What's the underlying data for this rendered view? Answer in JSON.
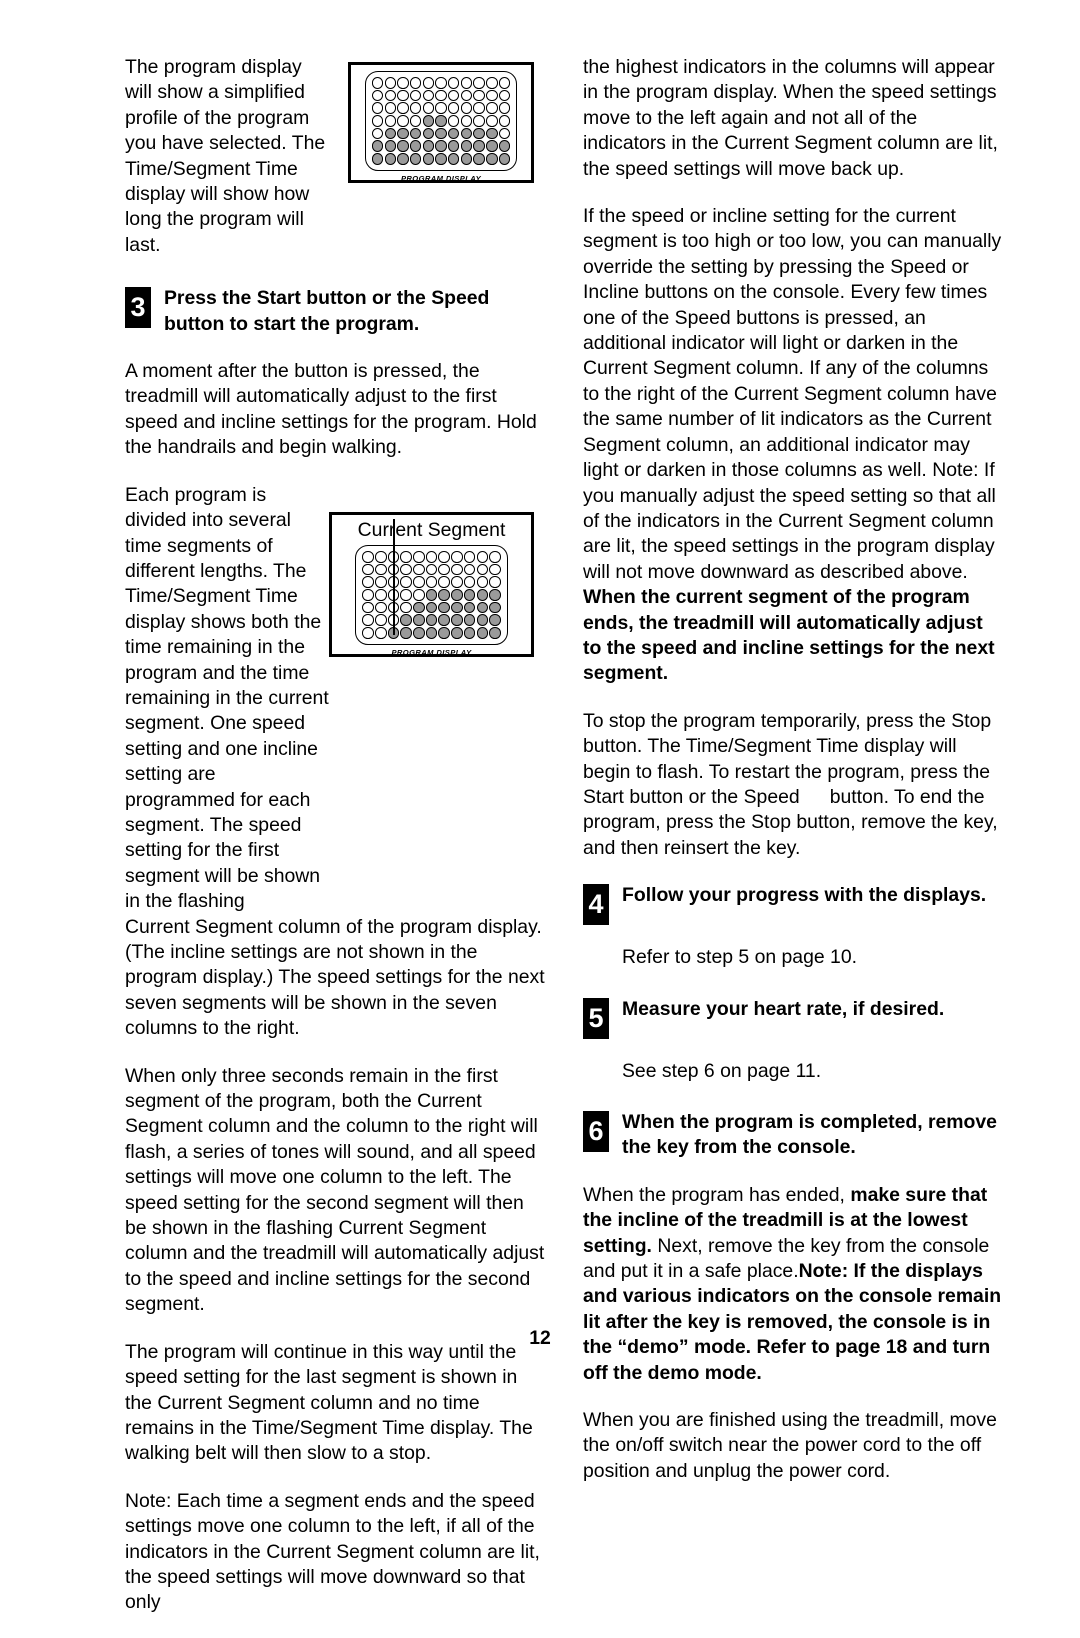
{
  "page": {
    "number": "12"
  },
  "figures": {
    "program_display": {
      "caption": "PROGRAM DISPLAY",
      "columns": 11,
      "rows": 7,
      "lit_cells": [
        [
          0,
          0,
          0,
          0,
          0,
          0,
          0,
          0,
          0,
          0,
          0
        ],
        [
          0,
          0,
          0,
          0,
          0,
          0,
          0,
          0,
          0,
          0,
          0
        ],
        [
          0,
          0,
          0,
          0,
          0,
          0,
          0,
          0,
          0,
          0,
          0
        ],
        [
          0,
          0,
          0,
          0,
          1,
          1,
          0,
          0,
          0,
          0,
          0
        ],
        [
          0,
          1,
          1,
          1,
          1,
          1,
          1,
          1,
          1,
          1,
          0
        ],
        [
          1,
          1,
          1,
          1,
          1,
          1,
          1,
          1,
          1,
          1,
          1
        ],
        [
          1,
          1,
          1,
          1,
          1,
          1,
          1,
          1,
          1,
          1,
          1
        ]
      ]
    },
    "current_segment": {
      "label": "Current Segment",
      "caption": "PROGRAM DISPLAY",
      "columns": 11,
      "rows": 7,
      "pointer_column": 3,
      "lit_cells": [
        [
          0,
          0,
          0,
          0,
          0,
          0,
          0,
          0,
          0,
          0,
          0
        ],
        [
          0,
          0,
          0,
          0,
          0,
          0,
          0,
          0,
          0,
          0,
          0
        ],
        [
          0,
          0,
          0,
          0,
          0,
          0,
          0,
          0,
          0,
          0,
          0
        ],
        [
          0,
          0,
          0,
          0,
          0,
          1,
          1,
          1,
          1,
          1,
          1
        ],
        [
          0,
          0,
          0,
          0,
          1,
          1,
          1,
          1,
          1,
          1,
          1
        ],
        [
          0,
          0,
          0,
          1,
          1,
          1,
          1,
          1,
          1,
          1,
          1
        ],
        [
          0,
          0,
          1,
          1,
          1,
          1,
          1,
          1,
          1,
          1,
          1
        ]
      ]
    }
  },
  "left_column": {
    "para_intro": "The program display will show a simplified profile of the program you have selected. The Time/Segment Time display will show how long the program will last.",
    "step3": {
      "number": "3",
      "heading_part1": "Press the Start button or the Speed",
      "heading_part2": "button to start the program."
    },
    "para_moment": "A moment after the button is pressed, the treadmill will automatically adjust to the first speed and incline settings for the program. Hold the handrails and begin walking.",
    "para_segments": "Each program is divided into several time segments of different lengths. The Time/Segment Time display shows both the time remaining in the program and the time remaining in the current segment. One speed setting and one incline setting are programmed for each segment. The speed setting for the first segment will be shown in the flashing",
    "para_segments_cont": "Current Segment column of the program display. (The incline settings are not shown in the program display.) The speed settings for the next seven segments will be shown in the seven columns to the right.",
    "para_three_seconds": "When only three seconds remain in the first segment of the program, both the Current Segment column and the column to the right will flash, a series of tones will sound, and all speed settings will move one column to the left. The speed setting for the second segment will then be shown in the flashing Current Segment column and the treadmill will automatically adjust to the speed and incline settings for the second segment.",
    "para_continue": "The program will continue in this way until the speed setting for the last segment is shown in the Current Segment column and no time remains in the Time/Segment Time display. The walking belt will then slow to a stop.",
    "para_note": "Note: Each time a segment ends and the speed settings move one column to the left, if all of the indicators in the Current Segment column are lit, the speed settings will move downward so that only"
  },
  "right_column": {
    "para_highest": "the highest indicators in the columns will appear in the program display. When the speed settings move to the left again and not all of the indicators in the Current Segment column are lit, the speed settings will move back up.",
    "para_override_normal": "If the speed or incline setting for the current segment is too high or too low, you can manually override the setting by pressing the Speed or Incline buttons on the console. Every few times one of the Speed buttons is pressed, an additional indicator will light or darken in the Current Segment column. If any of the columns to the right of the Current Segment column have the same number of lit indicators as the Current Segment column, an additional indicator may light or darken in those columns as well. Note: If you manually adjust the speed setting so that all of the indicators in the Current Segment column are lit, the speed settings in the program display will not move downward as described above.",
    "para_override_bold": "When the current segment of the program ends, the treadmill will automatically adjust to the speed and incline settings for the next segment.",
    "para_stop_part1": "To stop the program temporarily, press the Stop button. The Time/Segment Time display will begin to flash. To restart the program, press the Start button or the Speed",
    "para_stop_part2": "button. To end the program, press the Stop button, remove the key, and then reinsert the key.",
    "step4": {
      "number": "4",
      "heading": "Follow your progress with the displays.",
      "body": "Refer to step 5 on page 10."
    },
    "step5": {
      "number": "5",
      "heading": "Measure your heart rate, if desired.",
      "body": "See step 6 on page 11."
    },
    "step6": {
      "number": "6",
      "heading": "When the program is completed, remove the key from the console."
    },
    "para_ended_normal1": "When the program has ended,",
    "para_ended_bold1": "make sure that the incline of the treadmill is at the lowest setting.",
    "para_ended_normal2": "Next, remove the key from the console and put it in a safe place.",
    "para_ended_bold2": "Note: If the displays and various indicators on the console remain lit after the key is removed, the console is in the “demo” mode. Refer to page 18 and turn off the demo mode.",
    "para_finished": "When you are finished using the treadmill, move the on/off switch near the power cord to the off position and unplug the power cord."
  }
}
